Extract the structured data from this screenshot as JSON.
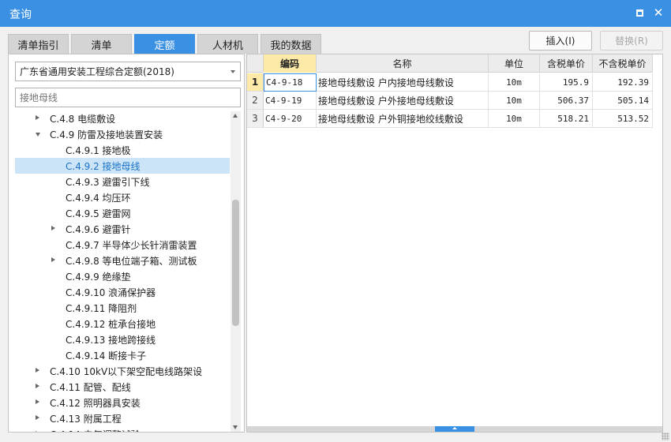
{
  "window": {
    "title": "查询"
  },
  "tabs": [
    {
      "label": "清单指引"
    },
    {
      "label": "清单"
    },
    {
      "label": "定额",
      "active": true
    },
    {
      "label": "人材机"
    },
    {
      "label": "我的数据"
    }
  ],
  "actions": {
    "insert_label": "插入(I)",
    "replace_label": "替换(R)"
  },
  "left": {
    "dropdown_value": "广东省通用安装工程综合定额(2018)",
    "search_placeholder": "接地母线",
    "tree": [
      {
        "label": "C.4.8 电缆敷设",
        "level": 0,
        "expander": "right"
      },
      {
        "label": "C.4.9 防雷及接地装置安装",
        "level": 0,
        "expander": "down"
      },
      {
        "label": "C.4.9.1 接地极",
        "level": 1,
        "expander": ""
      },
      {
        "label": "C.4.9.2 接地母线",
        "level": 1,
        "expander": "",
        "selected": true
      },
      {
        "label": "C.4.9.3 避雷引下线",
        "level": 1,
        "expander": ""
      },
      {
        "label": "C.4.9.4 均压环",
        "level": 1,
        "expander": ""
      },
      {
        "label": "C.4.9.5 避雷网",
        "level": 1,
        "expander": ""
      },
      {
        "label": "C.4.9.6 避雷针",
        "level": 1,
        "expander": "right"
      },
      {
        "label": "C.4.9.7 半导体少长针消雷装置",
        "level": 1,
        "expander": ""
      },
      {
        "label": "C.4.9.8 等电位端子箱、测试板",
        "level": 1,
        "expander": "right"
      },
      {
        "label": "C.4.9.9 绝缘垫",
        "level": 1,
        "expander": ""
      },
      {
        "label": "C.4.9.10 浪涌保护器",
        "level": 1,
        "expander": ""
      },
      {
        "label": "C.4.9.11 降阻剂",
        "level": 1,
        "expander": ""
      },
      {
        "label": "C.4.9.12 桩承台接地",
        "level": 1,
        "expander": ""
      },
      {
        "label": "C.4.9.13 接地跨接线",
        "level": 1,
        "expander": ""
      },
      {
        "label": "C.4.9.14 断接卡子",
        "level": 1,
        "expander": ""
      },
      {
        "label": "C.4.10 10kV以下架空配电线路架设",
        "level": 0,
        "expander": "right"
      },
      {
        "label": "C.4.11 配管、配线",
        "level": 0,
        "expander": "right"
      },
      {
        "label": "C.4.12 照明器具安装",
        "level": 0,
        "expander": "right"
      },
      {
        "label": "C.4.13 附属工程",
        "level": 0,
        "expander": "right"
      },
      {
        "label": "C.4.14 电气调整试验",
        "level": 0,
        "expander": "right"
      }
    ]
  },
  "grid": {
    "columns": [
      "编码",
      "名称",
      "单位",
      "含税单价",
      "不含税单价"
    ],
    "rows": [
      {
        "num": "1",
        "code": "C4-9-18",
        "name": "接地母线敷设 户内接地母线敷设",
        "unit": "10m",
        "price_tax": "195.9",
        "price_notax": "192.39"
      },
      {
        "num": "2",
        "code": "C4-9-19",
        "name": "接地母线敷设 户外接地母线敷设",
        "unit": "10m",
        "price_tax": "506.37",
        "price_notax": "505.14"
      },
      {
        "num": "3",
        "code": "C4-9-20",
        "name": "接地母线敷设 户外铜接地绞线敷设",
        "unit": "10m",
        "price_tax": "518.21",
        "price_notax": "513.52"
      }
    ]
  },
  "icons": {
    "maximize": "maximize-icon",
    "close": "close-icon",
    "dropdown": "chevron-down-icon"
  },
  "colors": {
    "accent": "#3a90e3",
    "highlight": "#fde9a8",
    "selection": "#cce4f7"
  }
}
